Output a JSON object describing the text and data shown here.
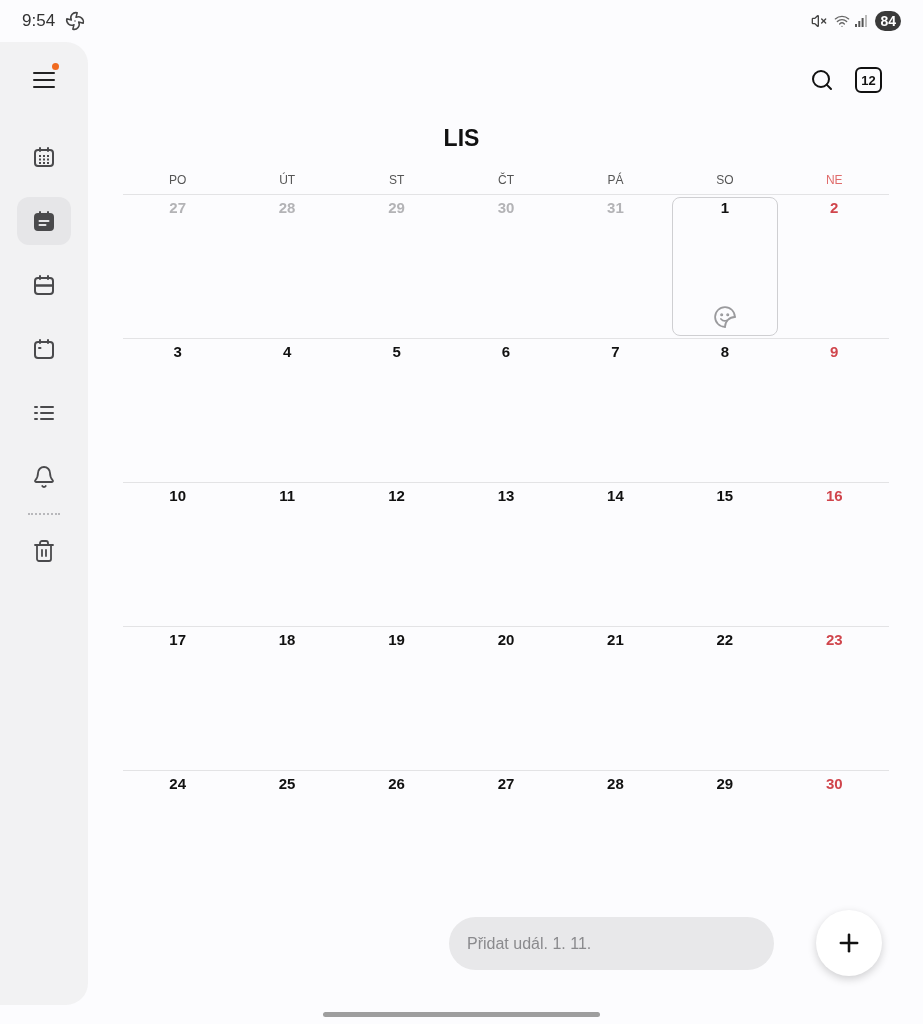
{
  "status_bar": {
    "time": "9:54",
    "battery": "84"
  },
  "sidebar": {
    "menu_badge": true,
    "items": [
      {
        "kind": "grid",
        "selected": false
      },
      {
        "kind": "agenda",
        "selected": true
      },
      {
        "kind": "bar",
        "selected": false
      },
      {
        "kind": "dot",
        "selected": false
      },
      {
        "kind": "list",
        "selected": false
      },
      {
        "kind": "bell",
        "selected": false
      }
    ],
    "bottom_items": [
      {
        "kind": "trash",
        "selected": false
      }
    ]
  },
  "toolbar": {
    "today_label": "12"
  },
  "calendar": {
    "title": "LIS",
    "weekdays": [
      {
        "label": "PO",
        "holiday": false
      },
      {
        "label": "ÚT",
        "holiday": false
      },
      {
        "label": "ST",
        "holiday": false
      },
      {
        "label": "ČT",
        "holiday": false
      },
      {
        "label": "PÁ",
        "holiday": false
      },
      {
        "label": "SO",
        "holiday": false
      },
      {
        "label": "NE",
        "holiday": true
      }
    ],
    "weeks": [
      [
        {
          "day": "27",
          "outside": true,
          "selected": false
        },
        {
          "day": "28",
          "outside": true,
          "selected": false
        },
        {
          "day": "29",
          "outside": true,
          "selected": false
        },
        {
          "day": "30",
          "outside": true,
          "selected": false
        },
        {
          "day": "31",
          "outside": true,
          "selected": false
        },
        {
          "day": "1",
          "outside": false,
          "selected": true
        },
        {
          "day": "2",
          "outside": false,
          "selected": false
        }
      ],
      [
        {
          "day": "3",
          "outside": false,
          "selected": false
        },
        {
          "day": "4",
          "outside": false,
          "selected": false
        },
        {
          "day": "5",
          "outside": false,
          "selected": false
        },
        {
          "day": "6",
          "outside": false,
          "selected": false
        },
        {
          "day": "7",
          "outside": false,
          "selected": false
        },
        {
          "day": "8",
          "outside": false,
          "selected": false
        },
        {
          "day": "9",
          "outside": false,
          "selected": false
        }
      ],
      [
        {
          "day": "10",
          "outside": false,
          "selected": false
        },
        {
          "day": "11",
          "outside": false,
          "selected": false
        },
        {
          "day": "12",
          "outside": false,
          "selected": false
        },
        {
          "day": "13",
          "outside": false,
          "selected": false
        },
        {
          "day": "14",
          "outside": false,
          "selected": false
        },
        {
          "day": "15",
          "outside": false,
          "selected": false
        },
        {
          "day": "16",
          "outside": false,
          "selected": false
        }
      ],
      [
        {
          "day": "17",
          "outside": false,
          "selected": false
        },
        {
          "day": "18",
          "outside": false,
          "selected": false
        },
        {
          "day": "19",
          "outside": false,
          "selected": false
        },
        {
          "day": "20",
          "outside": false,
          "selected": false
        },
        {
          "day": "21",
          "outside": false,
          "selected": false
        },
        {
          "day": "22",
          "outside": false,
          "selected": false
        },
        {
          "day": "23",
          "outside": false,
          "selected": false
        }
      ],
      [
        {
          "day": "24",
          "outside": false,
          "selected": false
        },
        {
          "day": "25",
          "outside": false,
          "selected": false
        },
        {
          "day": "26",
          "outside": false,
          "selected": false
        },
        {
          "day": "27",
          "outside": false,
          "selected": false
        },
        {
          "day": "28",
          "outside": false,
          "selected": false
        },
        {
          "day": "29",
          "outside": false,
          "selected": false
        },
        {
          "day": "30",
          "outside": false,
          "selected": false
        }
      ]
    ]
  },
  "add_event": {
    "placeholder": "Přidat udál. 1. 11."
  }
}
